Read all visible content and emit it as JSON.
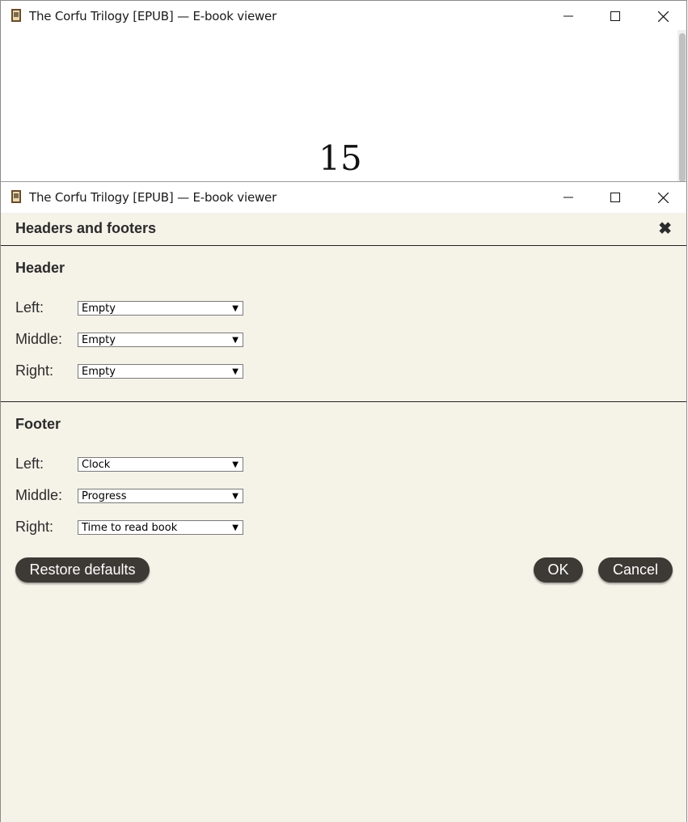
{
  "back_window": {
    "title": "The Corfu Trilogy [EPUB] — E-book viewer",
    "page_number": "15"
  },
  "front_window": {
    "title": "The Corfu Trilogy [EPUB] — E-book viewer"
  },
  "dialog": {
    "title": "Headers and footers",
    "close_glyph": "✖",
    "header": {
      "title": "Header",
      "rows": [
        {
          "label": "Left:",
          "value": "Empty"
        },
        {
          "label": "Middle:",
          "value": "Empty"
        },
        {
          "label": "Right:",
          "value": "Empty"
        }
      ]
    },
    "footer": {
      "title": "Footer",
      "rows": [
        {
          "label": "Left:",
          "value": "Clock"
        },
        {
          "label": "Middle:",
          "value": "Progress"
        },
        {
          "label": "Right:",
          "value": "Time to read book"
        }
      ]
    },
    "buttons": {
      "restore": "Restore defaults",
      "ok": "OK",
      "cancel": "Cancel"
    }
  },
  "icons": {
    "app": "book-icon",
    "minimize": "minimize-icon",
    "maximize": "maximize-icon",
    "close": "close-icon",
    "dropdown": "dropdown-arrow-icon"
  },
  "colors": {
    "dialog_bg": "#f5f2e8",
    "button_bg": "#3d3a35",
    "text": "#2b2b2b"
  }
}
